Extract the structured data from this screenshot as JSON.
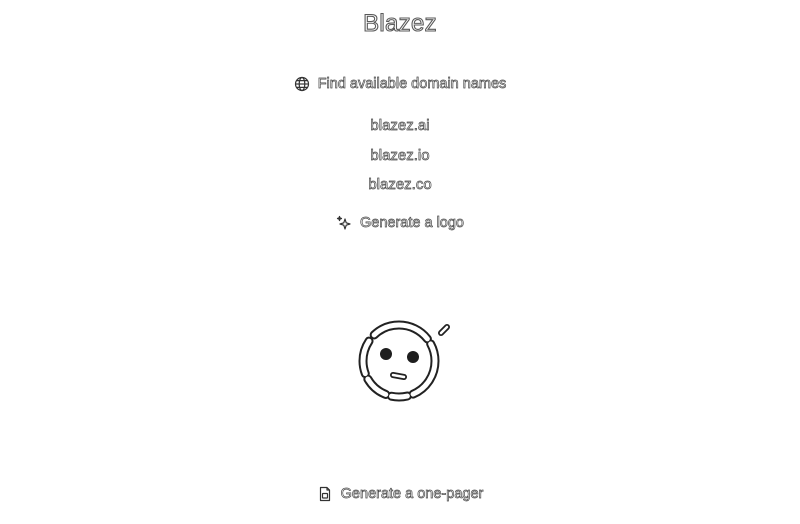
{
  "app": {
    "title": "Blazez"
  },
  "find_domains": {
    "label": "Find available domain names",
    "icon": "globe-icon"
  },
  "domains": [
    "blazez.ai",
    "blazez.io",
    "blazez.co"
  ],
  "generate_logo": {
    "label": "Generate a logo",
    "icon": "sparkle-icon"
  },
  "logo": {
    "icon": "smiley-logo"
  },
  "generate_onepager": {
    "label": "Generate a one-pager",
    "icon": "document-icon"
  }
}
